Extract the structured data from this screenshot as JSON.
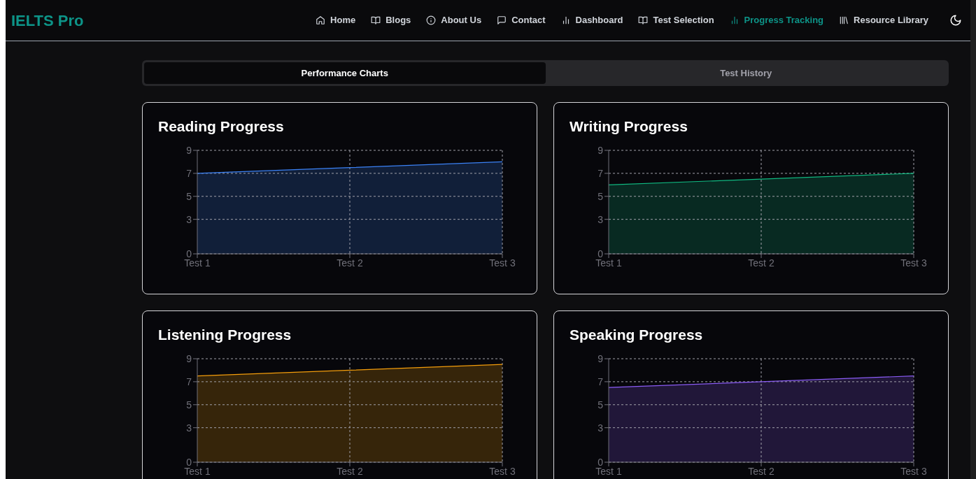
{
  "logo": "IELTS Pro",
  "nav": [
    {
      "label": "Home",
      "selected": false
    },
    {
      "label": "Blogs",
      "selected": false
    },
    {
      "label": "About Us",
      "selected": false
    },
    {
      "label": "Contact",
      "selected": false
    },
    {
      "label": "Dashboard",
      "selected": false
    },
    {
      "label": "Test Selection",
      "selected": false
    },
    {
      "label": "Progress Tracking",
      "selected": true
    },
    {
      "label": "Resource Library",
      "selected": false
    }
  ],
  "tabs": [
    {
      "label": "Performance Charts",
      "selected": true
    },
    {
      "label": "Test History",
      "selected": false
    }
  ],
  "cards": [
    {
      "title": "Reading Progress",
      "chart_data": {
        "type": "area",
        "grid": true,
        "categories": [
          "Test 1",
          "Test 2",
          "Test 3"
        ],
        "series": [
          {
            "color": "#3b82f6",
            "values": [
              7,
              7.5,
              8
            ]
          }
        ],
        "ylim": [
          0,
          9
        ],
        "yticks": [
          0,
          3,
          5,
          7,
          9
        ]
      }
    },
    {
      "title": "Writing Progress",
      "chart_data": {
        "type": "area",
        "grid": true,
        "categories": [
          "Test 1",
          "Test 2",
          "Test 3"
        ],
        "series": [
          {
            "color": "#10b981",
            "values": [
              6,
              6.5,
              7
            ]
          }
        ],
        "ylim": [
          0,
          9
        ],
        "yticks": [
          0,
          3,
          5,
          7,
          9
        ]
      }
    },
    {
      "title": "Listening Progress",
      "chart_data": {
        "type": "area",
        "grid": true,
        "categories": [
          "Test 1",
          "Test 2",
          "Test 3"
        ],
        "series": [
          {
            "color": "#f59e0b",
            "values": [
              7.5,
              8,
              8.5
            ]
          }
        ],
        "ylim": [
          0,
          9
        ],
        "yticks": [
          0,
          3,
          5,
          7,
          9
        ]
      }
    },
    {
      "title": "Speaking Progress",
      "chart_data": {
        "type": "area",
        "grid": true,
        "categories": [
          "Test 1",
          "Test 2",
          "Test 3"
        ],
        "series": [
          {
            "color": "#8b5cf6",
            "values": [
              6.5,
              7,
              7.5
            ]
          }
        ],
        "ylim": [
          0,
          9
        ],
        "yticks": [
          0,
          3,
          5,
          7,
          9
        ]
      }
    }
  ]
}
